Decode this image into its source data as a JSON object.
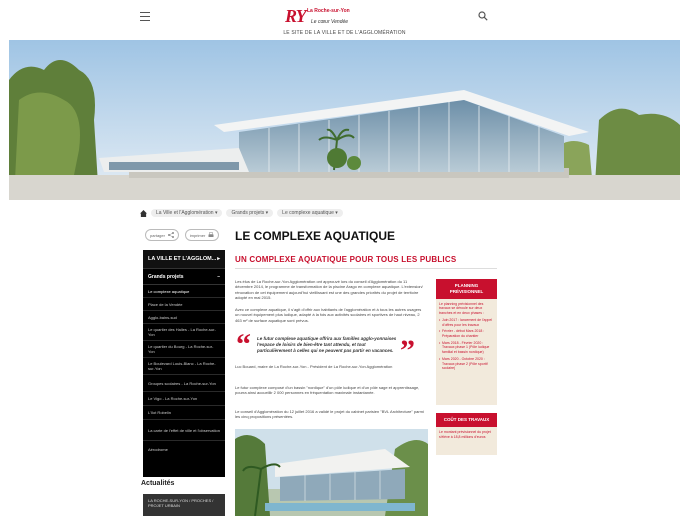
{
  "header": {
    "logo_mark": "RY",
    "logo_name": "La Roche-sur-Yon",
    "logo_slogan": "Le cœur Vendée",
    "tagline": "LE SITE DE LA VILLE ET DE L'AGGLOMÉRATION"
  },
  "breadcrumb": [
    "La Ville et l'Agglomération",
    "Grands projets",
    "Le complexe aquatique"
  ],
  "share": {
    "share_label": "partager",
    "print_label": "imprimer"
  },
  "sidebar": {
    "top_label": "LA VILLE ET L'AGGLOM...",
    "section_label": "Grands projets",
    "items": [
      "Le complexe aquatique",
      "Place de la Vendée",
      "Agglo-bains-sud",
      "Le quartier des Halles - La Roche-sur-Yon",
      "Le quartier du Bourg - La Roche-sur-Yon",
      "Le Boulevard Louis-Blanc - La Roche-sur-Yon",
      "Groupes scolaires - La Roche-sur-Yon",
      "Le Vigo - La Roche-sur-Yon",
      "L'îlot Robelin",
      "La carte de l'effet de ville et l'observation",
      "Aérodrome"
    ]
  },
  "actualites": {
    "title": "Actualités",
    "card_text": "LA ROCHE-SUR-YON / PROCHES / PROJET URBAIN"
  },
  "main": {
    "title": "LE COMPLEXE AQUATIQUE",
    "subtitle": "UN COMPLEXE AQUATIQUE POUR TOUS LES PUBLICS",
    "p1": "Les élus de La Roche-sur-Yon Agglomération ont approuvé lors du conseil d'Agglomération du 11 décembre 2014, le programme de transformation de la piscine Arago en complexe aquatique. L'extension/ rénovation de cet équipement aujourd'hui vieillissant est une des grandes priorités du projet de territoire adopté en mai 2015.",
    "p2": "Avec ce complexe aquatique, il s'agit d'offrir aux habitants de l'agglomération et à tous les autres usagers un nouvel équipement plus ludique, adapté à la fois aux activités scolaires et sportives de haut niveau, 2 463 m² de surface aquatique sont prévus.",
    "quote": "Le futur complexe aquatique offrira aux familles agglo-yonnaises l'espace de loisirs de bien-être tant attendu, et tout particulièrement à celles qui ne peuvent pas partir en vacances.",
    "quote_author": "Luc Bouard, maire de La Roche-sur-Yon - Président de La Roche-sur-Yon Agglomération",
    "p3": "Le futur complexe composé d'un bassin \"nordique\" d'un pôle ludique et d'un pôle sage et apprentissage, pourra ainsi accueillir 2 000 personnes en fréquentation maximale instantanée.",
    "p4": "Le conseil d'Agglomération du 12 juillet 2016 a validé le projet du cabinet parisien \"BVL Architecture\" parmi les cinq propositions présentées."
  },
  "planning": {
    "title": "PLANNING PRÉVISIONNEL",
    "intro": "Le planning prévisionnel des travaux se déroule sur deux tranches et en deux phases :",
    "items": [
      "Juin 2017 : lancement de l'appel d'offres pour les travaux",
      "Février - début Mars 2018 : Préparation du chantier",
      "Mars 2018 - Février 2020 : Travaux phase 1 (Pôle ludique familial et bassin nordique)",
      "Mars 2020 - Octobre 2020 : Travaux phase 2 (Pôle sportif scolaire)"
    ]
  },
  "cout": {
    "title": "COÛT DES TRAVAUX",
    "text": "Le montant prévisionnel du projet s'élève à 18,8 millions d'euros"
  },
  "colors": {
    "accent": "#c8102e",
    "panel_bg": "#f2eadc",
    "sidebar_bg": "#000000"
  }
}
